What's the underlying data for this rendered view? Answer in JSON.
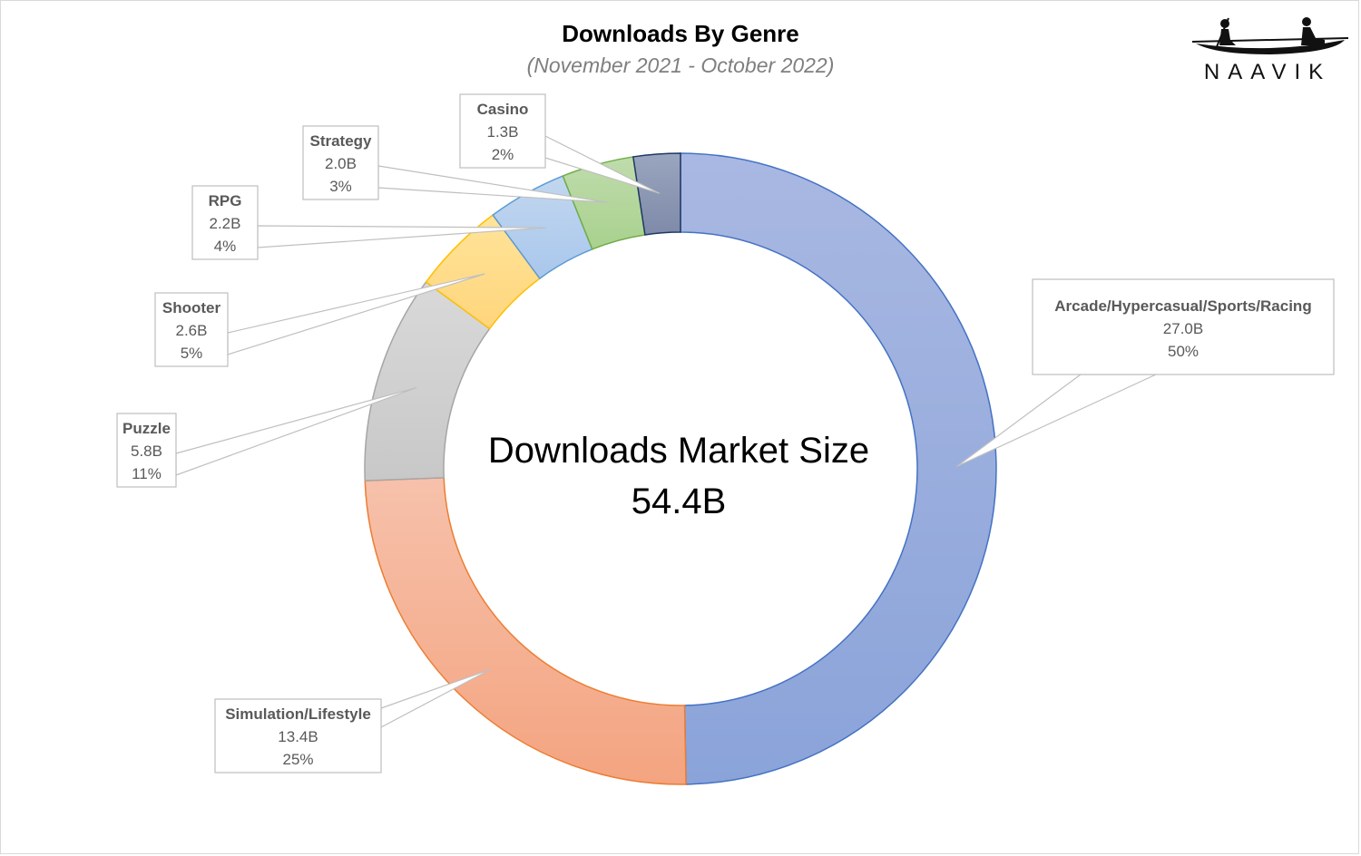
{
  "brand": "NAAVIK",
  "icons": {
    "logo": "canoe-rowers-icon"
  },
  "chart_data": {
    "type": "pie",
    "title": "Downloads By Genre",
    "subtitle": "(November 2021 - October 2022)",
    "center_label": "Downloads Market Size",
    "center_value": "54.4B",
    "slices": [
      {
        "name": "Arcade/Hypercasual/Sports/Racing",
        "value_label": "27.0B",
        "percent_label": "50%",
        "value": 27.0,
        "percent": 50,
        "color_top": "#a9b8e2",
        "color_bottom": "#8aa3d9",
        "stroke": "#4472c4"
      },
      {
        "name": "Simulation/Lifestyle",
        "value_label": "13.4B",
        "percent_label": "25%",
        "value": 13.4,
        "percent": 25,
        "color_top": "#f6c1ab",
        "color_bottom": "#f4a480",
        "stroke": "#ed7d31"
      },
      {
        "name": "Puzzle",
        "value_label": "5.8B",
        "percent_label": "11%",
        "value": 5.8,
        "percent": 11,
        "color_top": "#d9d9d9",
        "color_bottom": "#c8c8c8",
        "stroke": "#a5a5a5"
      },
      {
        "name": "Shooter",
        "value_label": "2.6B",
        "percent_label": "5%",
        "value": 2.6,
        "percent": 5,
        "color_top": "#ffe49a",
        "color_bottom": "#ffd57c",
        "stroke": "#ffc000"
      },
      {
        "name": "RPG",
        "value_label": "2.2B",
        "percent_label": "4%",
        "value": 2.2,
        "percent": 4,
        "color_top": "#c2d7ef",
        "color_bottom": "#a9c7ec",
        "stroke": "#5b9bd5"
      },
      {
        "name": "Strategy",
        "value_label": "2.0B",
        "percent_label": "3%",
        "value": 2.0,
        "percent": 3,
        "color_top": "#bfdcac",
        "color_bottom": "#a9d18e",
        "stroke": "#70ad47"
      },
      {
        "name": "Casino",
        "value_label": "1.3B",
        "percent_label": "2%",
        "value": 1.3,
        "percent": 2,
        "color_top": "#9aa5bf",
        "color_bottom": "#7e8aa8",
        "stroke": "#1f3864"
      }
    ]
  }
}
